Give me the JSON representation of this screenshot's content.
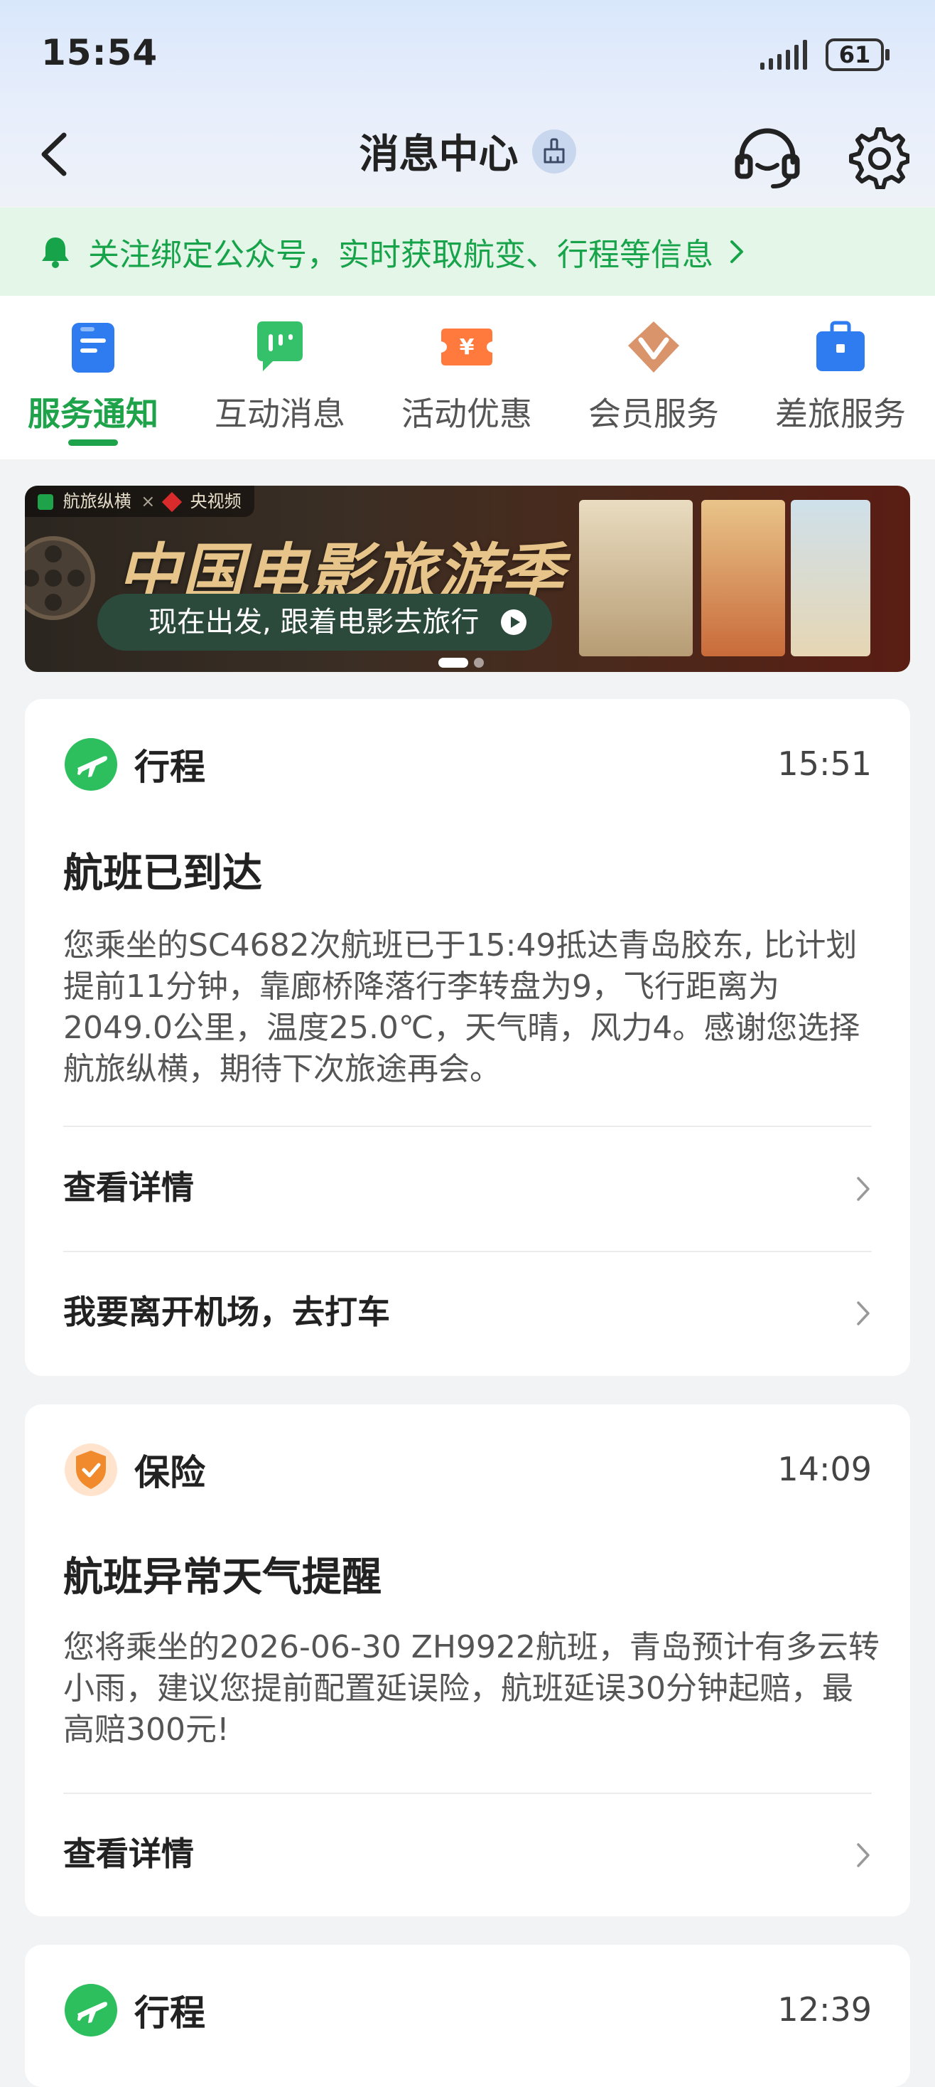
{
  "status_bar": {
    "time": "15:54",
    "battery": "61"
  },
  "nav": {
    "title": "消息中心"
  },
  "follow_banner": {
    "text": "关注绑定公众号，实时获取航变、行程等信息"
  },
  "tabs": [
    {
      "label": "服务通知",
      "icon": "service-notice-icon",
      "active": true
    },
    {
      "label": "互动消息",
      "icon": "chat-message-icon",
      "active": false
    },
    {
      "label": "活动优惠",
      "icon": "coupon-icon",
      "active": false
    },
    {
      "label": "会员服务",
      "icon": "member-gem-icon",
      "active": false
    },
    {
      "label": "差旅服务",
      "icon": "briefcase-icon",
      "active": false
    }
  ],
  "promo": {
    "source_left": "航旅纵横",
    "source_sep": "×",
    "source_right": "央视频",
    "title": "中国电影旅游季",
    "cta": "现在出发, 跟着电影去旅行"
  },
  "cards": [
    {
      "category": "行程",
      "time": "15:51",
      "title": "航班已到达",
      "body": "您乘坐的SC4682次航班已于15:49抵达青岛胶东, 比计划提前11分钟，靠廊桥降落行李转盘为9，飞行距离为2049.0公里，温度25.0℃，天气晴，风力4。感谢您选择航旅纵横，期待下次旅途再会。",
      "actions": [
        "查看详情",
        "我要离开机场，去打车"
      ]
    },
    {
      "category": "保险",
      "time": "14:09",
      "title": "航班异常天气提醒",
      "body": "您将乘坐的2026-06-30 ZH9922航班，青岛预计有多云转小雨，建议您提前配置延误险，航班延误30分钟起赔，最高赔300元!",
      "actions": [
        "查看详情"
      ]
    },
    {
      "category": "行程",
      "time": "12:39"
    }
  ],
  "colors": {
    "accent_green": "#1fa34a",
    "follow_bg": "#e4f6e8",
    "page_bg": "#f2f3f5"
  }
}
